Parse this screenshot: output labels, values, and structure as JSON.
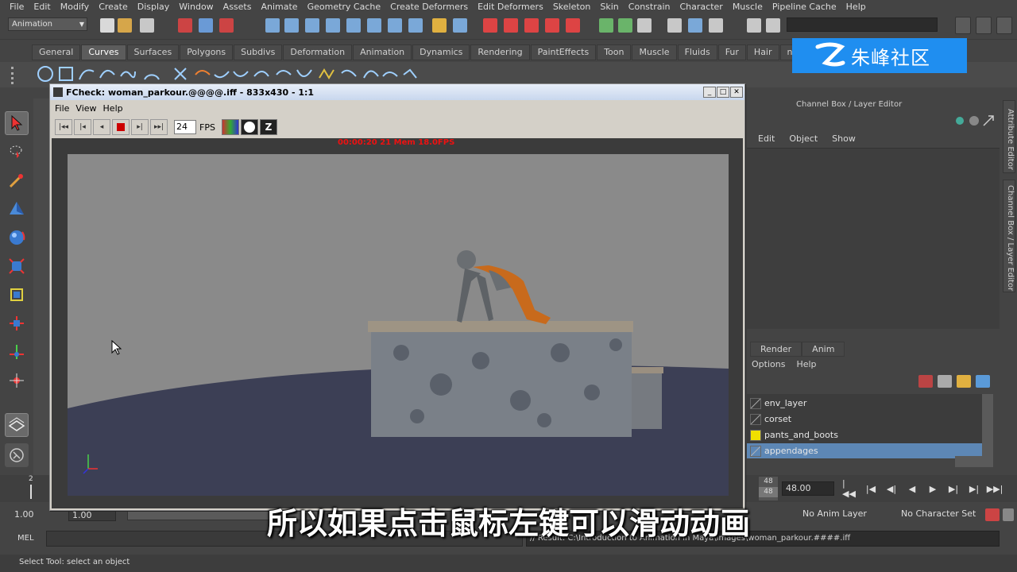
{
  "menubar": [
    "File",
    "Edit",
    "Modify",
    "Create",
    "Display",
    "Window",
    "Assets",
    "Animate",
    "Geometry Cache",
    "Create Deformers",
    "Edit Deformers",
    "Skeleton",
    "Skin",
    "Constrain",
    "Character",
    "Muscle",
    "Pipeline Cache",
    "Help"
  ],
  "statusline": {
    "mode": "Animation"
  },
  "shelf": {
    "tabs": [
      "General",
      "Curves",
      "Surfaces",
      "Polygons",
      "Subdivs",
      "Deformation",
      "Animation",
      "Dynamics",
      "Rendering",
      "PaintEffects",
      "Toon",
      "Muscle",
      "Fluids",
      "Fur",
      "Hair",
      "nClot"
    ],
    "active_tab": "Curves"
  },
  "fcheck": {
    "title": "FCheck: woman_parkour.@@@@.iff - 833x430 - 1:1",
    "menu": [
      "File",
      "View",
      "Help"
    ],
    "fps_value": "24",
    "fps_label": "FPS",
    "stats": "00:00:20   21  Mem 18.0FPS"
  },
  "channelbox": {
    "title": "Channel Box / Layer Editor",
    "menu": [
      "Edit",
      "Object",
      "Show"
    ],
    "layer_tabs": [
      "Render",
      "Anim"
    ],
    "layer_menu": [
      "Options",
      "Help"
    ],
    "layers": [
      {
        "name": "env_layer",
        "color": "",
        "selected": false
      },
      {
        "name": "corset",
        "color": "",
        "selected": false
      },
      {
        "name": "pants_and_boots",
        "color": "#f0e000",
        "selected": false
      },
      {
        "name": "appendages",
        "color": "",
        "selected": true
      }
    ]
  },
  "side_tabs": [
    "Attribute Editor",
    "Channel Box / Layer Editor"
  ],
  "timeslider": {
    "frame_marker": "2",
    "end_frame_top": "48",
    "end_frame_bottom": "48",
    "current_time": "48.00"
  },
  "range": {
    "start": "1.00",
    "playback_start": "1.00",
    "anim_layer": "No Anim Layer",
    "character_set": "No Character Set"
  },
  "cmdline": {
    "label": "MEL",
    "result": "// Result: C:\\Introduction to Animation in Maya\\images\\woman_parkour.####.iff"
  },
  "helpline": "Select Tool: select an object",
  "watermark": "朱峰社区",
  "subtitle": "所以如果点击鼠标左键可以滑动动画"
}
